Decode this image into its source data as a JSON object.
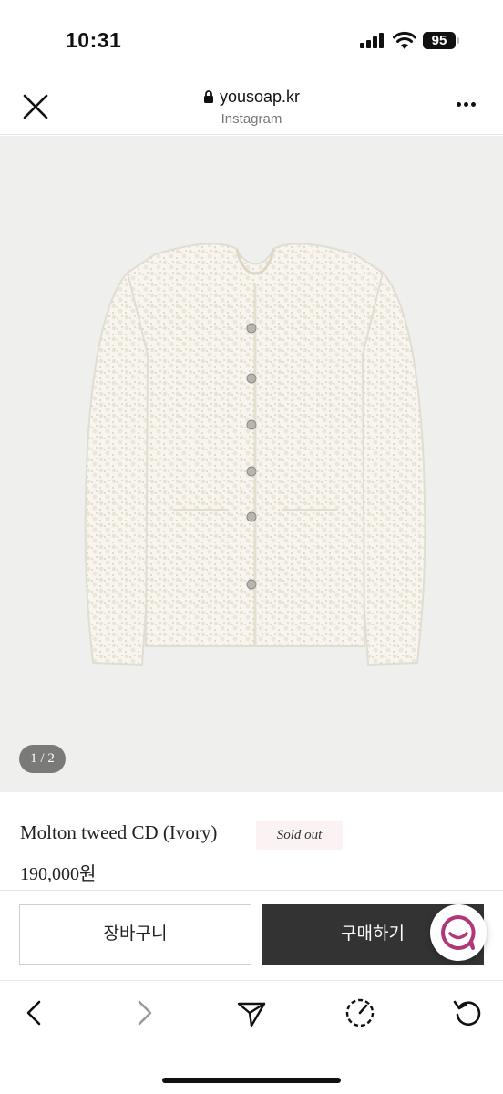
{
  "status_bar": {
    "time": "10:31",
    "battery": "95",
    "icons": [
      "signal-icon",
      "wifi-icon",
      "battery-icon"
    ]
  },
  "browser": {
    "url": "yousoap.kr",
    "subtitle": "Instagram",
    "icons": [
      "close-icon",
      "lock-icon",
      "more-icon"
    ]
  },
  "gallery": {
    "pager": "1 / 2",
    "image_alt": "ivory tweed cardigan",
    "background": "#efefed"
  },
  "product": {
    "title": "Molton tweed CD (Ivory)",
    "badge": "Sold out",
    "price": "190,000원"
  },
  "actions": {
    "cart_label": "장바구니",
    "buy_label": "구매하기",
    "chat_icon": "chat-icon",
    "buy_color": "#333333",
    "chat_color": "#b0387a"
  },
  "toolbar": {
    "icons": [
      "back-icon",
      "forward-icon",
      "share-icon",
      "history-icon",
      "reload-icon"
    ]
  }
}
